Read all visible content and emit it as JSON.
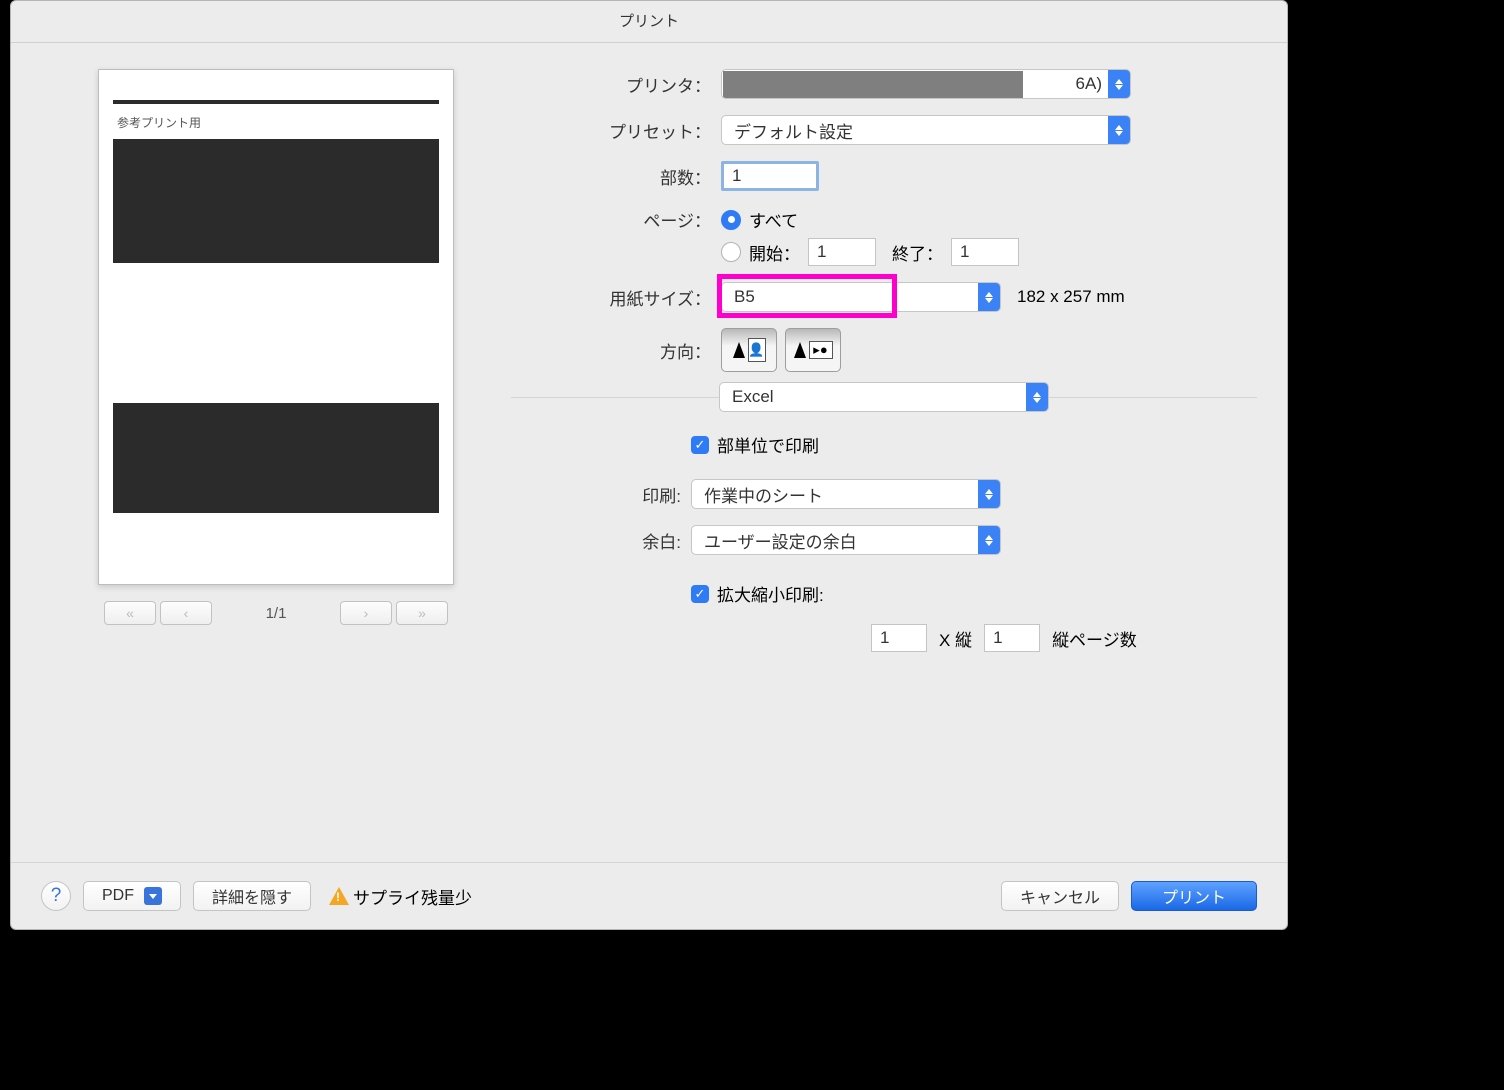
{
  "title": "プリント",
  "labels": {
    "printer": "プリンタ：",
    "preset": "プリセット：",
    "copies": "部数：",
    "pages": "ページ：",
    "all": "すべて",
    "from": "開始：",
    "to": "終了：",
    "paperSize": "用紙サイズ：",
    "orientation": "方向：",
    "collate": "部単位で印刷",
    "print": "印刷:",
    "margins": "余白:",
    "scale": "拡大縮小印刷:",
    "xVertical": "X 縦",
    "verticalPages": "縦ページ数"
  },
  "values": {
    "printerSuffix": "6A)",
    "preset": "デフォルト設定",
    "copies": "1",
    "from": "1",
    "to": "1",
    "paperSize": "B5",
    "paperDim": "182 x 257 mm",
    "appSection": "Excel",
    "printTarget": "作業中のシート",
    "margins": "ユーザー設定の余白",
    "scaleW": "1",
    "scaleH": "1"
  },
  "preview": {
    "caption": "参考プリント用",
    "pageCount": "1/1"
  },
  "footer": {
    "pdf": "PDF",
    "hideDetails": "詳細を隠す",
    "supplyLow": "サプライ残量少",
    "cancel": "キャンセル",
    "print": "プリント"
  }
}
